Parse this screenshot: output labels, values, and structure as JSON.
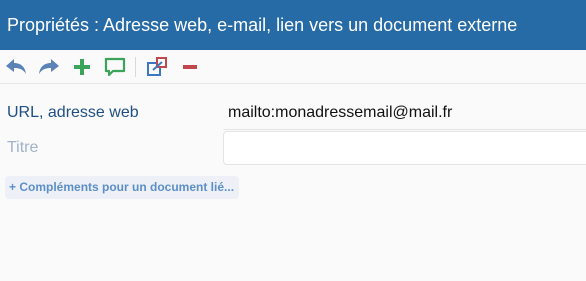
{
  "window": {
    "title": "Propriétés : Adresse web, e-mail, lien vers un document externe"
  },
  "toolbar": {
    "buttons": [
      {
        "name": "undo",
        "icon": "undo-arrow-icon",
        "color": "#5b83b8"
      },
      {
        "name": "redo",
        "icon": "redo-arrow-icon",
        "color": "#5b83b8"
      },
      {
        "name": "add",
        "icon": "plus-icon",
        "color": "#3ba35a"
      },
      {
        "name": "comment",
        "icon": "speech-bubble-icon",
        "color": "#3ba35a"
      },
      {
        "name": "open-external",
        "icon": "external-link-icon",
        "color": "#3a78c2"
      },
      {
        "name": "remove",
        "icon": "minus-icon",
        "color": "#c0474b"
      }
    ]
  },
  "form": {
    "url_label": "URL, adresse web",
    "url_value": "mailto:monadressemail@mail.fr",
    "titre_label": "Titre",
    "titre_value": "",
    "complements_link": "+ Compléments pour un document lié..."
  },
  "colors": {
    "titlebar": "#266aa6",
    "label": "#1f4f82",
    "muted_label": "#a0b3c8",
    "link": "#5c8fc7"
  }
}
